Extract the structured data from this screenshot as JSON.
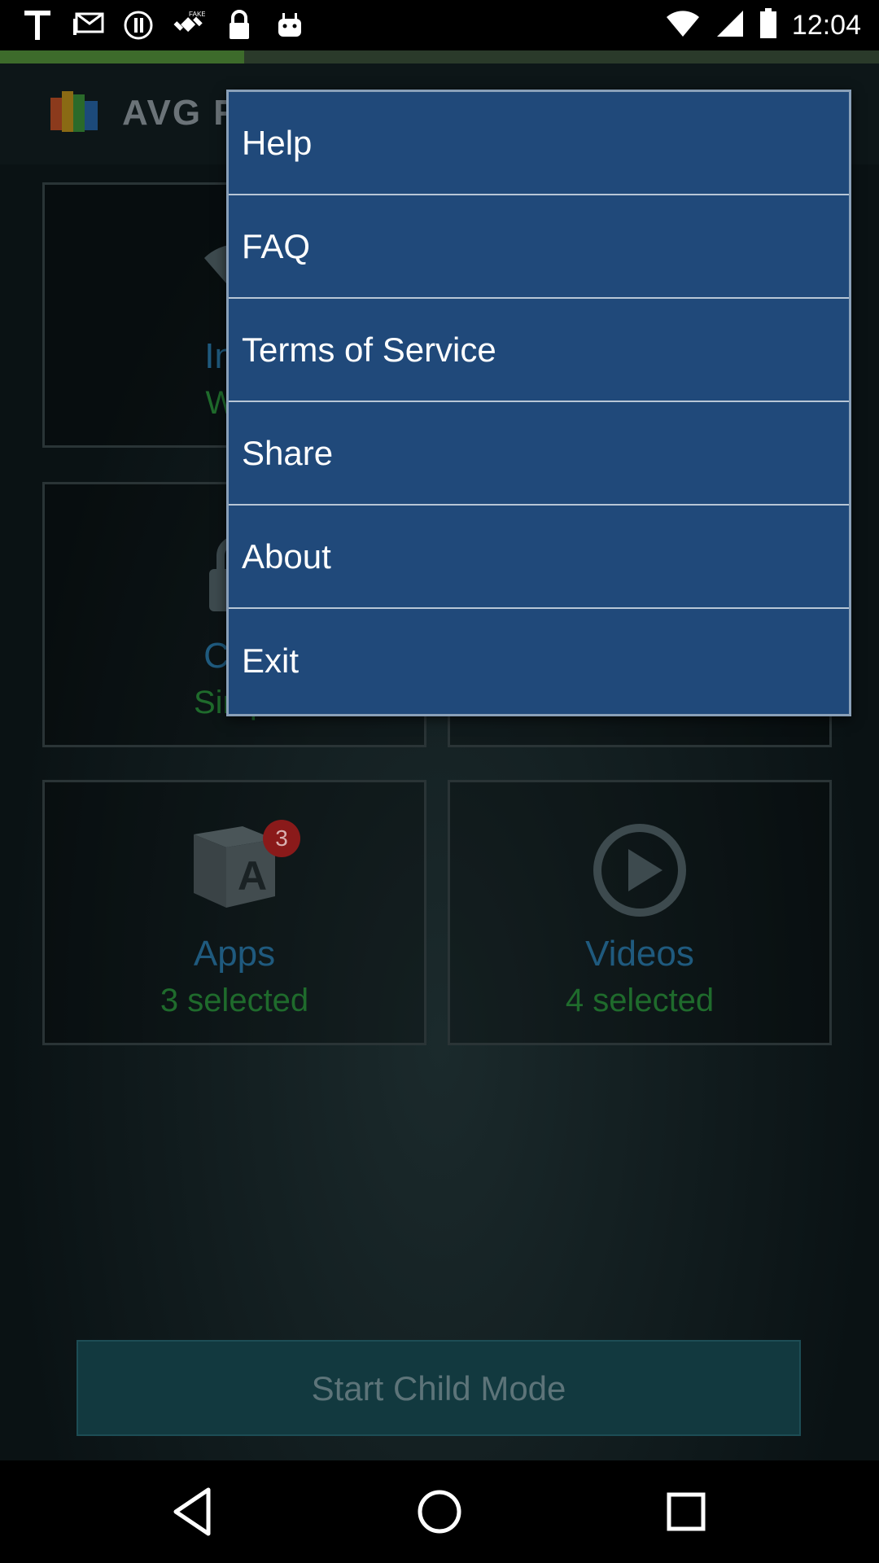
{
  "status_bar": {
    "time": "12:04",
    "left_icons": [
      "text-icon",
      "mail-icon",
      "alert-icon",
      "fake-gps-icon",
      "lock-icon",
      "android-icon"
    ],
    "right_icons": [
      "wifi-icon",
      "cellular-signal-icon",
      "battery-icon"
    ]
  },
  "app": {
    "title": "AVG F",
    "tiles": [
      {
        "title": "Inte",
        "subtitle": "WiF",
        "icon": "wifi-icon"
      },
      {
        "title": "Chil",
        "subtitle": "Simpl",
        "icon": "lock-icon"
      },
      {
        "title": "Apps",
        "subtitle": "3 selected",
        "icon": "app-cube-icon",
        "badge": "3"
      },
      {
        "title": "Videos",
        "subtitle": "4 selected",
        "icon": "play-icon"
      }
    ],
    "start_button": "Start Child Mode"
  },
  "menu": {
    "items": [
      "Help",
      "FAQ",
      "Terms of Service",
      "Share",
      "About",
      "Exit"
    ]
  },
  "colors": {
    "menu_bg": "#20497a",
    "tile_title": "#1f5a7e",
    "tile_subtitle": "#1f6b2c"
  }
}
